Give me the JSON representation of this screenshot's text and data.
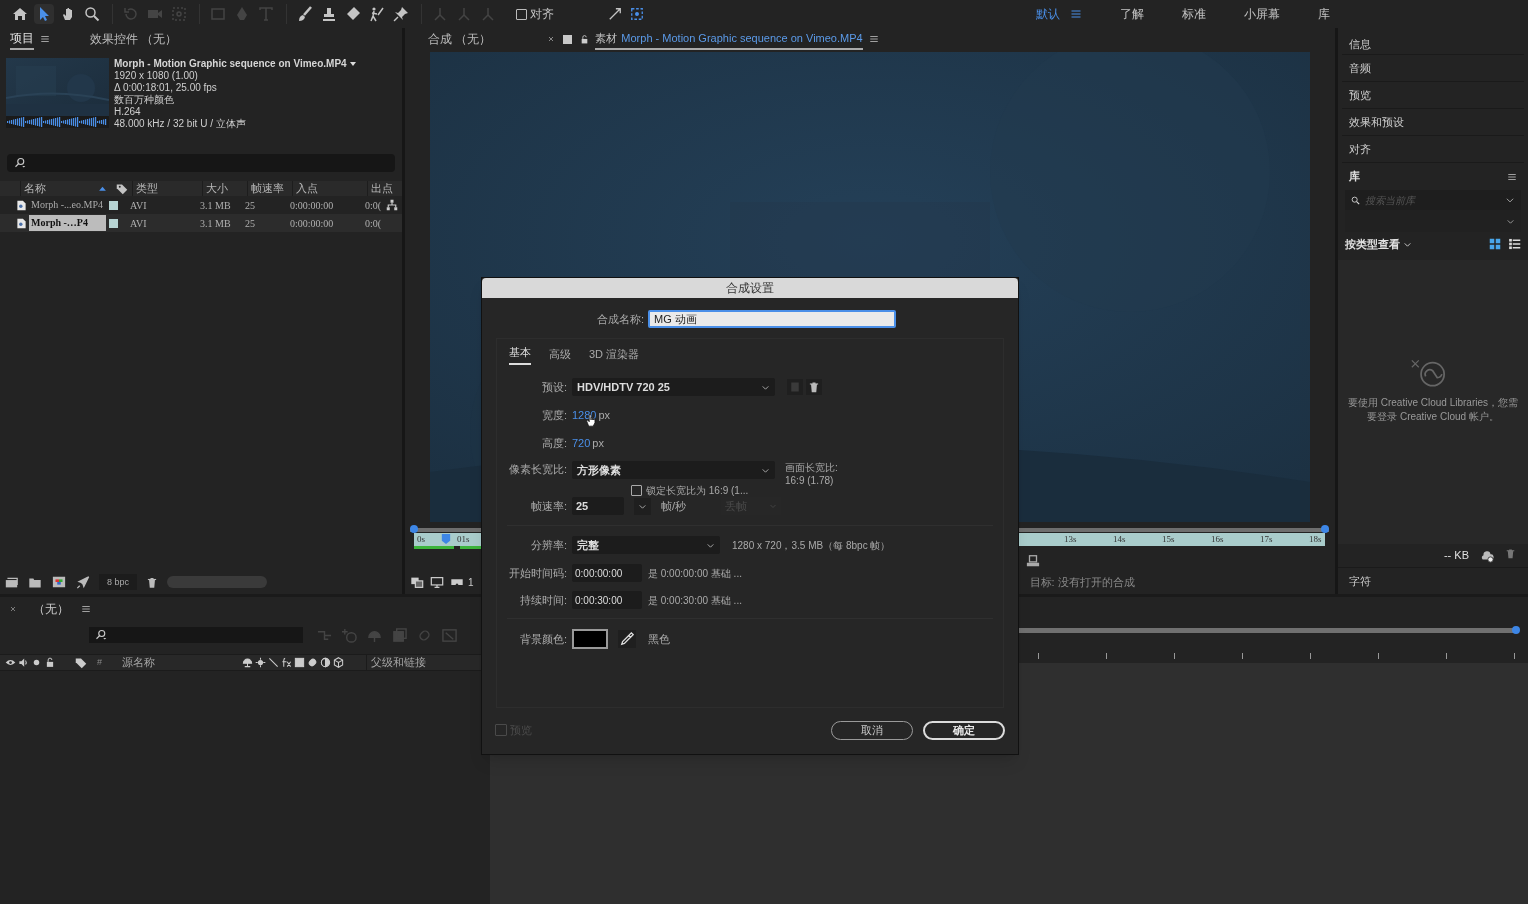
{
  "toolbar": {
    "tool_groups": [
      [
        {
          "kind": "home",
          "selected": false,
          "disabled": false
        },
        {
          "kind": "select",
          "selected": true,
          "disabled": false
        },
        {
          "kind": "hand",
          "selected": false,
          "disabled": false
        },
        {
          "kind": "zoom",
          "selected": false,
          "disabled": false
        }
      ],
      [
        {
          "kind": "rotate",
          "selected": false,
          "disabled": true
        },
        {
          "kind": "camera",
          "selected": false,
          "disabled": true
        },
        {
          "kind": "pan",
          "selected": false,
          "disabled": true
        }
      ],
      [
        {
          "kind": "rect",
          "selected": false,
          "disabled": true
        },
        {
          "kind": "pen",
          "selected": false,
          "disabled": true
        },
        {
          "kind": "type",
          "selected": false,
          "disabled": true
        }
      ],
      [
        {
          "kind": "brush",
          "selected": false,
          "disabled": false
        },
        {
          "kind": "stamp",
          "selected": false,
          "disabled": false
        },
        {
          "kind": "eraser",
          "selected": false,
          "disabled": false
        },
        {
          "kind": "roto",
          "selected": false,
          "disabled": false
        },
        {
          "kind": "pin",
          "selected": false,
          "disabled": false
        }
      ],
      [
        {
          "kind": "axis",
          "selected": false,
          "disabled": true
        },
        {
          "kind": "axis",
          "selected": false,
          "disabled": true
        },
        {
          "kind": "axis",
          "selected": false,
          "disabled": true
        }
      ]
    ],
    "snap": {
      "label": "对齐",
      "checked": false
    },
    "workspaces": [
      {
        "label": "默认",
        "selected": true
      },
      {
        "label": "了解",
        "selected": false
      },
      {
        "label": "标准",
        "selected": false
      },
      {
        "label": "小屏幕",
        "selected": false
      },
      {
        "label": "库",
        "selected": false
      }
    ]
  },
  "project_panel": {
    "tabs": [
      {
        "label": "项目",
        "selected": true
      },
      {
        "label": "效果控件 （无）",
        "selected": false
      }
    ],
    "footage_info": {
      "title": "Morph - Motion Graphic sequence on Vimeo.MP4",
      "lines": [
        "1920 x 1080 (1.00)",
        "Δ 0:00:18:01, 25.00 fps",
        "数百万种颜色",
        "H.264",
        "48.000 kHz / 32 bit U / 立体声"
      ]
    },
    "columns": [
      "名称",
      "类型",
      "大小",
      "帧速率",
      "入点",
      "出点"
    ],
    "rows": [
      {
        "name": "Morph -...eo.MP4",
        "type": "AVI",
        "size": "3.1 MB",
        "fps": "25",
        "in": "0:00:00:00",
        "out": "0:0(",
        "selected": false,
        "flowchart": true
      },
      {
        "name": "Morph -…P4",
        "type": "AVI",
        "size": "3.1 MB",
        "fps": "25",
        "in": "0:00:00:00",
        "out": "0:0(",
        "selected": true,
        "flowchart": false
      }
    ],
    "bpc": "8 bpc"
  },
  "viewer": {
    "tabs": [
      {
        "label": "合成 （无）",
        "selected": false,
        "closable": false
      },
      {
        "prefix": "素材",
        "label": "Morph - Motion Graphic sequence on Vimeo.MP4",
        "selected": true,
        "closable": true
      }
    ],
    "ruler_left": [
      "0s",
      "01s"
    ],
    "ruler_right": [
      "13s",
      "14s",
      "15s",
      "16s",
      "17s",
      "18s"
    ],
    "zoom_partial": "1",
    "target": "目标: 没有打开的合成"
  },
  "right_panel": {
    "items": [
      "信息",
      "音频",
      "预览",
      "效果和预设",
      "对齐"
    ],
    "library": {
      "title": "库",
      "search_placeholder": "搜索当前库",
      "view_by": "按类型查看",
      "grid_view": true,
      "message": "要使用 Creative Cloud Libraries，您需要登录 Creative Cloud 帐户。",
      "size": "-- KB"
    },
    "items_after": [
      "字符"
    ]
  },
  "timeline": {
    "tab": "（无）",
    "columns": [
      "#",
      "源名称",
      "父级和链接"
    ]
  },
  "dialog": {
    "title": "合成设置",
    "name_label": "合成名称:",
    "name_value": "MG 动画",
    "tabs": [
      {
        "label": "基本",
        "selected": true
      },
      {
        "label": "高级",
        "selected": false
      },
      {
        "label": "3D 渲染器",
        "selected": false
      }
    ],
    "preset": {
      "label": "预设:",
      "value": "HDV/HDTV 720 25"
    },
    "width": {
      "label": "宽度:",
      "value": "1280",
      "unit": "px"
    },
    "height": {
      "label": "高度:",
      "value": "720",
      "unit": "px"
    },
    "lock_aspect": {
      "label": "锁定长宽比为 16:9 (1...",
      "checked": false
    },
    "pixel_aspect": {
      "label": "像素长宽比:",
      "value": "方形像素"
    },
    "frame_aspect": {
      "label": "画面长宽比:",
      "value": "16:9 (1.78)"
    },
    "frame_rate": {
      "label": "帧速率:",
      "value": "25",
      "unit": "帧/秒",
      "drop_frame": "丢帧",
      "drop_frame_disabled": true
    },
    "resolution": {
      "label": "分辨率:",
      "value": "完整",
      "info": "1280 x 720，3.5 MB（每 8bpc 帧）"
    },
    "start": {
      "label": "开始时间码:",
      "value": "0:00:00:00",
      "info": "是 0:00:00:00 基础 ..."
    },
    "duration": {
      "label": "持续时间:",
      "value": "0:00:30:00",
      "info": "是 0:00:30:00 基础 ..."
    },
    "background": {
      "label": "背景颜色:",
      "color": "#000000",
      "name": "黑色"
    },
    "preview": {
      "label": "预览",
      "checked": false,
      "disabled": true
    },
    "buttons": [
      {
        "label": "取消",
        "kind": "cancel"
      },
      {
        "label": "确定",
        "kind": "ok"
      }
    ]
  }
}
